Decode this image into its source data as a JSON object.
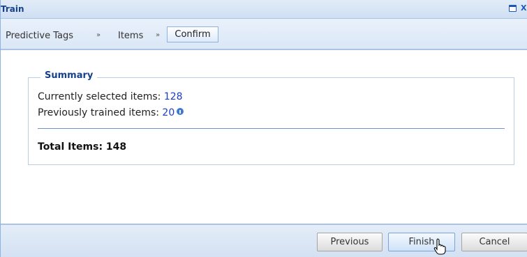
{
  "window": {
    "title": "Train",
    "close_glyph": "X"
  },
  "breadcrumb": {
    "items": [
      "Predictive Tags",
      "Items",
      "Confirm"
    ],
    "separator": "»",
    "active_index": 2
  },
  "summary": {
    "legend": "Summary",
    "selected_label": "Currently selected items: ",
    "selected_value": "128",
    "trained_label": "Previously trained items: ",
    "trained_value": "20",
    "total_label": "Total Items: 148"
  },
  "buttons": {
    "previous": "Previous",
    "finish": "Finish",
    "cancel": "Cancel"
  },
  "icons": {
    "info": "info-icon",
    "maximize": "maximize-icon",
    "close": "close-icon",
    "cursor": "hand-cursor-icon"
  },
  "colors": {
    "title": "#15428b",
    "link_value": "#1a3ccc",
    "panel_border": "#8db2e3"
  }
}
